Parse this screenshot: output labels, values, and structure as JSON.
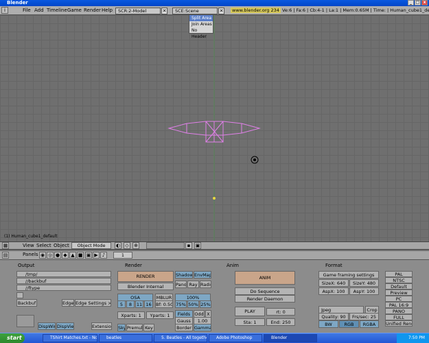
{
  "window": {
    "title": "Blender",
    "controls": [
      "_",
      "□",
      "x"
    ]
  },
  "menubar": {
    "items": [
      "File",
      "Add",
      "Timeline",
      "Game",
      "Render",
      "Help"
    ],
    "screen": "SCR:2-Model",
    "scene": "SCE:Scene",
    "url": "www.blender.org 234",
    "stats": "Ve:6 | Fa:6 | Cb:4-1 | La:1 | Mem:0.65M | Time: | Human_cube1_default"
  },
  "dropdown": {
    "items": [
      "Split Area",
      "Join Areas",
      "No Header"
    ]
  },
  "viewport": {
    "object_label": "(1) Human_cube1_default"
  },
  "header3d": {
    "view": "View",
    "select": "Select",
    "object": "Object",
    "mode": "Object Mode"
  },
  "panels_header": {
    "label": "Panels",
    "frame": "1"
  },
  "output": {
    "title": "Output",
    "paths": [
      "/tmp/",
      "//backbuf",
      "//ftype"
    ],
    "backbuf": "Backbuf",
    "edge": "Edge",
    "edge_settings": "Edge Settings >>",
    "dispwin": "DispWin",
    "dispview": "DispView",
    "extensions": "Extensions"
  },
  "render": {
    "title": "Render",
    "render_button": "RENDER",
    "engine": "Blender Internal",
    "osa": "OSA",
    "osa_vals": [
      "5",
      "8",
      "11",
      "16"
    ],
    "mblur": "MBLUR",
    "bf": "Bf: 0.50",
    "pct": "100%",
    "pct_vals": [
      "75%",
      "50%",
      "25%"
    ],
    "shadow": "Shadow",
    "envmap": "EnvMap",
    "pano": "Pano",
    "ray": "Ray",
    "radio": "Radio",
    "xparts": "Xparts: 1",
    "yparts": "Yparts: 1",
    "fields": "Fields",
    "odd": "Odd",
    "x": "X",
    "gauss": "Gauss",
    "gauss_val": "1.00",
    "border": "Border",
    "gamma": "Gamma",
    "sky": "Sky",
    "premul": "Premul",
    "key": "Key"
  },
  "anim": {
    "title": "Anim",
    "anim_button": "ANIM",
    "do_sequence": "Do Sequence",
    "render_daemon": "Render Daemon",
    "play": "PLAY",
    "rt": "rt: 0",
    "sta": "Sta: 1",
    "end": "End: 250"
  },
  "format": {
    "title": "Format",
    "game": "Game framing settings",
    "sizex": "SizeX: 640",
    "sizey": "SizeY: 480",
    "aspx": "AspX: 100",
    "aspy": "AspY: 100",
    "presets": [
      "PAL",
      "NTSC",
      "Default",
      "Preview",
      "PC",
      "PAL 16:9",
      "PANO",
      "FULL",
      "Unified Rende"
    ],
    "jpeg": "Jpeg",
    "crop": "Crop",
    "quality": "Quality: 90",
    "fps": "Frs/sec: 25",
    "bw": "BW",
    "rgb": "RGB",
    "rgba": "RGBA"
  },
  "taskbar": {
    "start": "start",
    "tasks": [
      "TShirt Matches.txt - Note...",
      "beatles",
      "5. Beatles - All together n...",
      "Adobe Photoshop",
      "Blender"
    ],
    "time": "7:50 PM"
  }
}
